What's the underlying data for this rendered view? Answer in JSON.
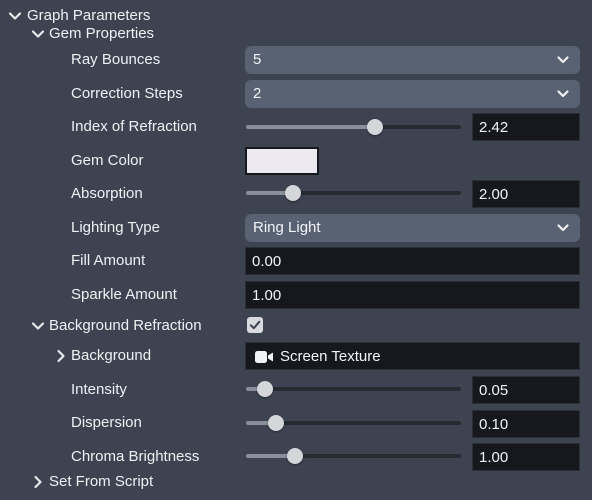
{
  "panel": {
    "graph_parameters": {
      "label": "Graph Parameters",
      "expanded": true,
      "chevron_icon": "chevron-down-icon"
    },
    "gem_properties": {
      "label": "Gem Properties",
      "expanded": true,
      "chevron_icon": "chevron-down-icon"
    },
    "ray_bounces": {
      "label": "Ray Bounces",
      "value": "5",
      "icon": "chevron-down-icon"
    },
    "correction_steps": {
      "label": "Correction Steps",
      "value": "2",
      "icon": "chevron-down-icon"
    },
    "index_of_refraction": {
      "label": "Index of Refraction",
      "value": "2.42",
      "slider_fraction": 0.6
    },
    "gem_color": {
      "label": "Gem Color",
      "color": "#ece9f0"
    },
    "absorption": {
      "label": "Absorption",
      "value": "2.00",
      "slider_fraction": 0.22
    },
    "lighting_type": {
      "label": "Lighting Type",
      "value": "Ring Light",
      "icon": "chevron-down-icon"
    },
    "fill_amount": {
      "label": "Fill Amount",
      "value": "0.00"
    },
    "sparkle_amount": {
      "label": "Sparkle Amount",
      "value": "1.00"
    },
    "background_refraction": {
      "label": "Background Refraction",
      "expanded": true,
      "checked": true,
      "chevron_icon": "chevron-down-icon",
      "check_icon": "checkmark-icon"
    },
    "background": {
      "label": "Background",
      "value": "Screen Texture",
      "expanded": false,
      "chevron_icon": "chevron-right-icon",
      "value_icon": "video-camera-icon"
    },
    "intensity": {
      "label": "Intensity",
      "value": "0.05",
      "slider_fraction": 0.09
    },
    "dispersion": {
      "label": "Dispersion",
      "value": "0.10",
      "slider_fraction": 0.14
    },
    "chroma_brightness": {
      "label": "Chroma Brightness",
      "value": "1.00",
      "slider_fraction": 0.23
    },
    "set_from_script": {
      "label": "Set From Script",
      "expanded": false,
      "chevron_icon": "chevron-right-icon"
    }
  },
  "colors": {
    "background": "#3d4350",
    "dropdown": "#596272",
    "input_field": "#16181d",
    "text": "#eef0f4"
  }
}
